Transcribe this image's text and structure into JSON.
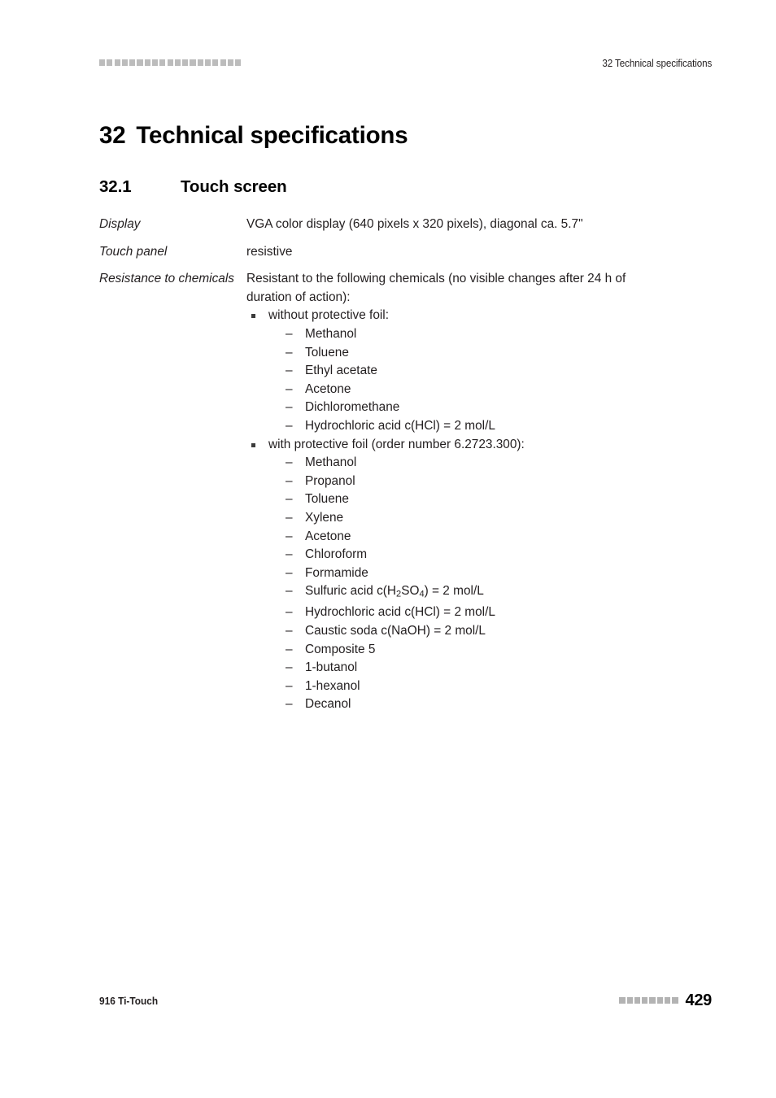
{
  "header": {
    "decoration_squares": 19,
    "title": "32 Technical specifications"
  },
  "chapter": {
    "number": "32",
    "title": "Technical specifications"
  },
  "section": {
    "number": "32.1",
    "title": "Touch screen"
  },
  "specs": [
    {
      "label": "Display",
      "value": "VGA color display (640 pixels x 320 pixels), diagonal ca. 5.7\""
    },
    {
      "label": "Touch panel",
      "value": "resistive"
    },
    {
      "label": "Resistance to chemicals",
      "intro": "Resistant to the following chemicals (no visible changes after 24 h of duration of action):",
      "groups": [
        {
          "heading": "without protective foil:",
          "items": [
            "Methanol",
            "Toluene",
            "Ethyl acetate",
            "Acetone",
            "Dichloromethane",
            "Hydrochloric acid c(HCl) = 2 mol/L"
          ]
        },
        {
          "heading": "with protective foil (order number 6.2723.300):",
          "items": [
            "Methanol",
            "Propanol",
            "Toluene",
            "Xylene",
            "Acetone",
            "Chloroform",
            "Formamide",
            "Sulfuric acid c(H2SO4) = 2 mol/L",
            "Hydrochloric acid c(HCl) = 2 mol/L",
            "Caustic soda c(NaOH) = 2 mol/L",
            "Composite 5",
            "1-butanol",
            "1-hexanol",
            "Decanol"
          ],
          "items_html": [
            "Methanol",
            "Propanol",
            "Toluene",
            "Xylene",
            "Acetone",
            "Chloroform",
            "Formamide",
            "Sulfuric acid c(H<sub>2</sub>SO<sub>4</sub>) = 2 mol/L",
            "Hydrochloric acid c(HCl) = 2 mol/L",
            "Caustic soda c(NaOH) = 2 mol/L",
            "Composite 5",
            "1-butanol",
            "1-hexanol",
            "Decanol"
          ]
        }
      ]
    }
  ],
  "footer": {
    "document_name": "916 Ti-Touch",
    "decoration_squares": 8,
    "page_number": "429"
  },
  "colors": {
    "text": "#231f20",
    "heading": "#000000",
    "decoration": "#bcbcbc",
    "bullet": "#3b3b3b",
    "background": "#ffffff"
  }
}
